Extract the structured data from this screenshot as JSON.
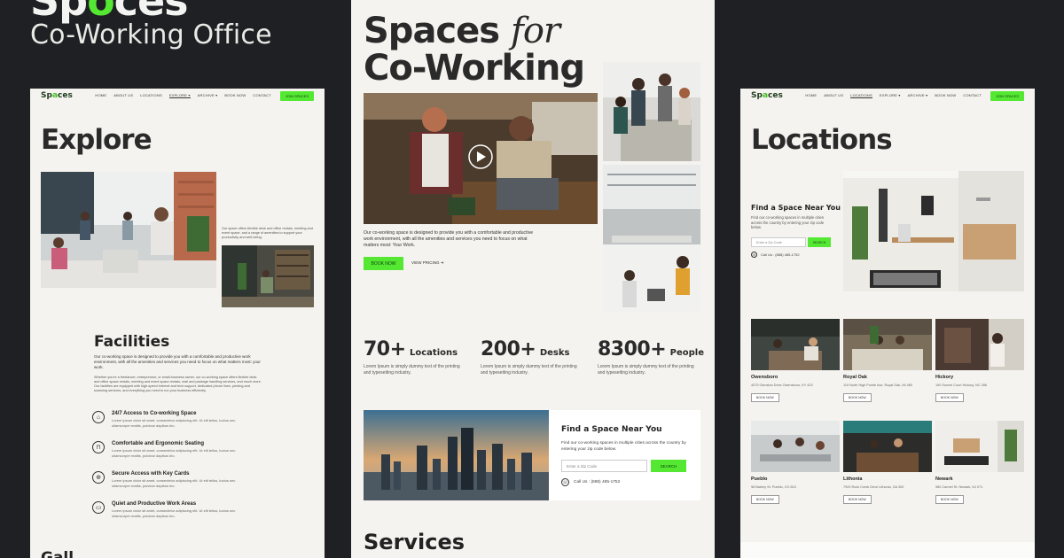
{
  "header": {
    "brand_prefix": "Sp",
    "brand_accent": "o",
    "brand_suffix": "ces",
    "subtitle": "Co-Working Office"
  },
  "logo": {
    "prefix": "Sp",
    "accent": "a",
    "suffix": "ces"
  },
  "nav": {
    "items": [
      "HOME",
      "ABOUT US",
      "LOCATIONS",
      "EXPLORE ▾",
      "ARCHIVE ▾",
      "BOOK NOW",
      "CONTACT"
    ],
    "join_label": "JOIN SPACES"
  },
  "left_page": {
    "title": "Explore",
    "aside_text": "Our space offers flexible desk and office rentals, meeting and event space, and a range of amenities to support your productivity and well-being.",
    "facilities_title": "Facilities",
    "facilities_intro": "Our co-working space is designed to provide you with a comfortable and productive work environment, with all the amenities and services you need to focus on what matters most: your work.",
    "facilities_body": "Whether you're a freelancer, entrepreneur, or small business owner, our co-working space offers flexible desk and office space rentals, meeting and event space rentals, mail and package handling services, and much more. Our facilities are equipped with high-speed internet and tech support, dedicated phone lines, printing and scanning services, and everything you need to run your business efficiently.",
    "features": [
      {
        "icon": "wifi-icon",
        "glyph": "⌂",
        "title": "24/7 Access to Co-working Space",
        "desc": "Lorem ipsum dolor sit amet, consectetur adipiscing elit. Ut elit tellus, luctus nec ullamcorper mattis, pulvinar dapibus leo."
      },
      {
        "icon": "chair-icon",
        "glyph": "⊓",
        "title": "Comfortable and Ergonomic Seating",
        "desc": "Lorem ipsum dolor sit amet, consectetur adipiscing elit. Ut elit tellus, luctus nec ullamcorper mattis, pulvinar dapibus leo."
      },
      {
        "icon": "lock-icon",
        "glyph": "⊕",
        "title": "Secure Access with Key Cards",
        "desc": "Lorem ipsum dolor sit amet, consectetur adipiscing elit. Ut elit tellus, luctus nec ullamcorper mattis, pulvinar dapibus leo."
      },
      {
        "icon": "laptop-icon",
        "glyph": "▭",
        "title": "Quiet and Productive Work Areas",
        "desc": "Lorem ipsum dolor sit amet, consectetur adipiscing elit. Ut elit tellus, luctus nec ullamcorper mattis, pulvinar dapibus leo."
      }
    ],
    "gallery_partial": "Gall"
  },
  "center_page": {
    "title_line1": "Spaces",
    "title_for": "for",
    "title_line2": "Co-Working",
    "intro": "Our co-working space is designed to provide you with a comfortable and productive work environment, with all the amenities and services you need to focus on what matters most: Your Work.",
    "book_label": "BOOK NOW",
    "view_label": "VIEW PRICING",
    "stats": [
      {
        "num": "70+",
        "label": "Locations",
        "desc": "Lorem Ipsum is simply dummy text of the printing and typesetting industry."
      },
      {
        "num": "200+",
        "label": "Desks",
        "desc": "Lorem Ipsum is simply dummy text of the printing and typesetting industry."
      },
      {
        "num": "8300+",
        "label": "People",
        "desc": "Lorem Ipsum is simply dummy text of the printing and typesetting industry."
      }
    ],
    "find_title": "Find a Space Near You",
    "find_desc": "Find our co-working spaces in multiple cities across the country by entering your zip code below.",
    "zip_placeholder": "Enter a Zip Code",
    "search_label": "SEARCH",
    "call": "Call Us : (888) 485-1752",
    "services_title": "Services"
  },
  "right_page": {
    "title": "Locations",
    "find_title": "Find a Space Near You",
    "find_desc": "Find our co-working spaces in multiple cities across the country by entering your zip code below.",
    "zip_placeholder": "Enter a Zip Code",
    "search_label": "SEARCH",
    "call": "Call Us : (888) 485-1752",
    "book_label": "BOOK NOW",
    "locations": [
      {
        "name": "Owensboro",
        "addr": "4075 Glenstan Drive Owensboro, KY 423"
      },
      {
        "name": "Royal Oak",
        "addr": "119 North High Pointe Ave, Royal Oak, MI 480"
      },
      {
        "name": "Hickory",
        "addr": "190 Sunnel Court Hickory, NC 286"
      },
      {
        "name": "Pueblo",
        "addr": "98 Bakery St. Pueblo, CO 810"
      },
      {
        "name": "Lithonia",
        "addr": "7920 Rock Creek Drive Lithonia, GA 300"
      },
      {
        "name": "Newark",
        "addr": "980 Carmel St. Newark, NJ 071"
      }
    ]
  },
  "colors": {
    "accent": "#55e832",
    "background": "#1e2023",
    "page": "#f4f3ef"
  }
}
